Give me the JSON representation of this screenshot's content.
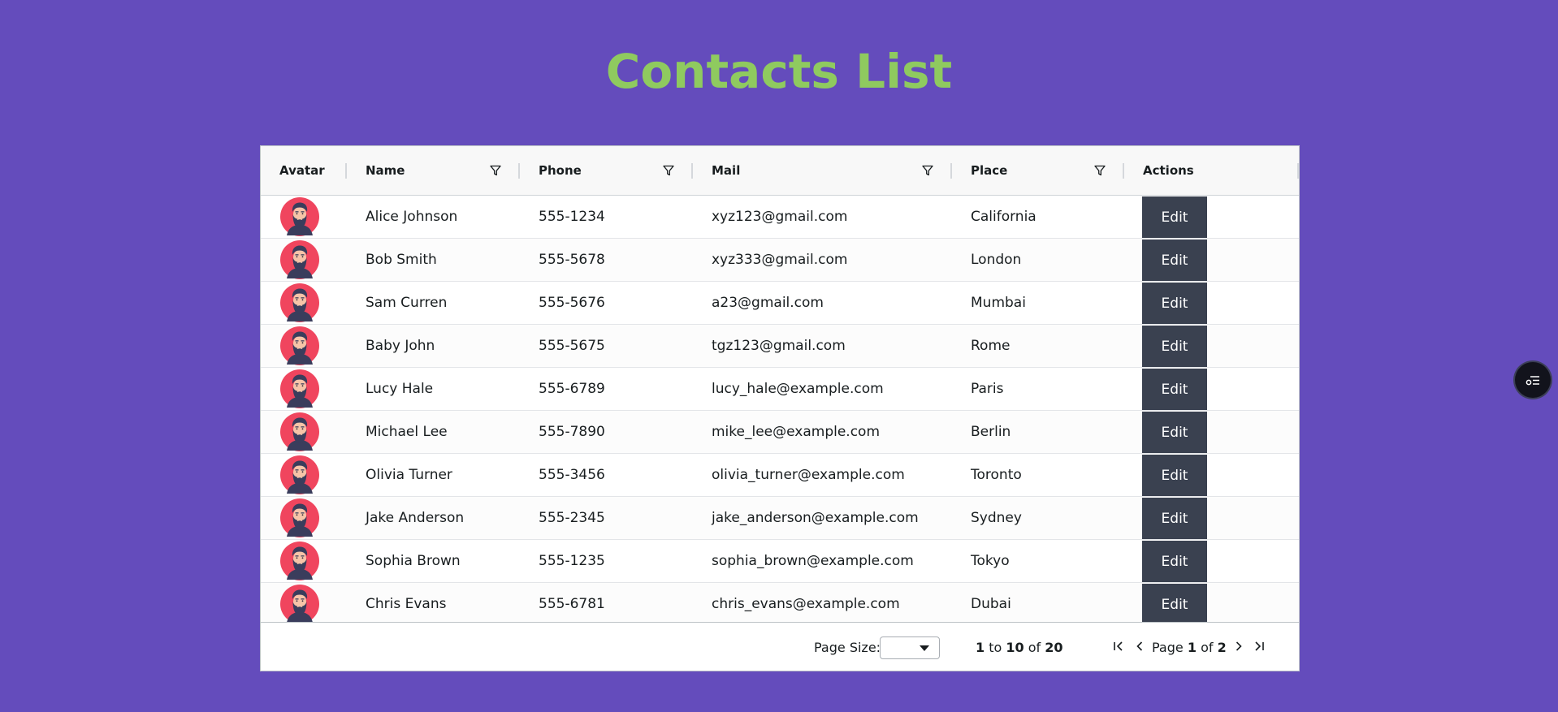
{
  "page": {
    "title": "Contacts List"
  },
  "grid": {
    "columns": [
      {
        "key": "avatar",
        "label": "Avatar",
        "filterable": false
      },
      {
        "key": "name",
        "label": "Name",
        "filterable": true
      },
      {
        "key": "phone",
        "label": "Phone",
        "filterable": true
      },
      {
        "key": "mail",
        "label": "Mail",
        "filterable": true
      },
      {
        "key": "place",
        "label": "Place",
        "filterable": true
      },
      {
        "key": "actions",
        "label": "Actions",
        "filterable": false
      }
    ],
    "rows": [
      {
        "name": "Alice Johnson",
        "phone": "555-1234",
        "mail": "xyz123@gmail.com",
        "place": "California",
        "action": "Edit"
      },
      {
        "name": "Bob Smith",
        "phone": "555-5678",
        "mail": "xyz333@gmail.com",
        "place": "London",
        "action": "Edit"
      },
      {
        "name": "Sam Curren",
        "phone": "555-5676",
        "mail": "a23@gmail.com",
        "place": "Mumbai",
        "action": "Edit"
      },
      {
        "name": "Baby John",
        "phone": "555-5675",
        "mail": "tgz123@gmail.com",
        "place": "Rome",
        "action": "Edit"
      },
      {
        "name": "Lucy Hale",
        "phone": "555-6789",
        "mail": "lucy_hale@example.com",
        "place": "Paris",
        "action": "Edit"
      },
      {
        "name": "Michael Lee",
        "phone": "555-7890",
        "mail": "mike_lee@example.com",
        "place": "Berlin",
        "action": "Edit"
      },
      {
        "name": "Olivia Turner",
        "phone": "555-3456",
        "mail": "olivia_turner@example.com",
        "place": "Toronto",
        "action": "Edit"
      },
      {
        "name": "Jake Anderson",
        "phone": "555-2345",
        "mail": "jake_anderson@example.com",
        "place": "Sydney",
        "action": "Edit"
      },
      {
        "name": "Sophia Brown",
        "phone": "555-1235",
        "mail": "sophia_brown@example.com",
        "place": "Tokyo",
        "action": "Edit"
      },
      {
        "name": "Chris Evans",
        "phone": "555-6781",
        "mail": "chris_evans@example.com",
        "place": "Dubai",
        "action": "Edit"
      }
    ]
  },
  "pagination": {
    "page_size_label": "Page Size:",
    "page_size_value": "",
    "row_from": "1",
    "row_to_word": "to",
    "row_to": "10",
    "row_of_word": "of",
    "row_total": "20",
    "page_word": "Page",
    "current_page": "1",
    "page_of_word": "of",
    "total_pages": "2"
  },
  "colors": {
    "background": "#644cbc",
    "title": "#8fca5f",
    "edit_button": "#3a4150",
    "avatar_bg": "#f0455e"
  },
  "icons": {
    "filter": "filter-icon",
    "first_page": "first-page-icon",
    "prev_page": "previous-page-icon",
    "next_page": "next-page-icon",
    "last_page": "last-page-icon",
    "floating": "settings-list-icon"
  }
}
